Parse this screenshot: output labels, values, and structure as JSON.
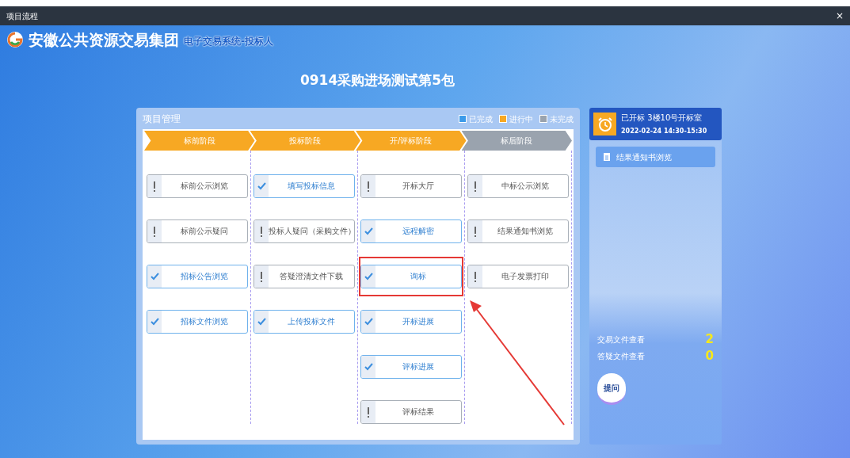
{
  "window": {
    "title": "项目流程",
    "close": "×"
  },
  "header": {
    "brand": "安徽公共资源交易集团",
    "subtitle": "电子交易系统-投标人"
  },
  "project_title": "0914采购进场测试第5包",
  "panel": {
    "title": "项目管理",
    "legend": [
      {
        "label": "已完成",
        "color": "#3d9be9"
      },
      {
        "label": "进行中",
        "color": "#f7a823"
      },
      {
        "label": "未完成",
        "color": "#9aa3ae"
      }
    ],
    "stages": [
      {
        "label": "标前阶段",
        "color": "#f7a823",
        "items": [
          {
            "label": "标前公示浏览",
            "done": false,
            "highlighted": false
          },
          {
            "label": "标前公示疑问",
            "done": false,
            "highlighted": false
          },
          {
            "label": "招标公告浏览",
            "done": true,
            "highlighted": false
          },
          {
            "label": "招标文件浏览",
            "done": true,
            "highlighted": false
          }
        ]
      },
      {
        "label": "投标阶段",
        "color": "#f7a823",
        "items": [
          {
            "label": "填写投标信息",
            "done": true,
            "highlighted": false
          },
          {
            "label": "投标人疑问（采购文件）",
            "done": false,
            "highlighted": false
          },
          {
            "label": "答疑澄清文件下载",
            "done": false,
            "highlighted": false
          },
          {
            "label": "上传投标文件",
            "done": true,
            "highlighted": false
          }
        ]
      },
      {
        "label": "开/评标阶段",
        "color": "#f7a823",
        "items": [
          {
            "label": "开标大厅",
            "done": false,
            "highlighted": false
          },
          {
            "label": "远程解密",
            "done": true,
            "highlighted": false
          },
          {
            "label": "询标",
            "done": true,
            "highlighted": true
          },
          {
            "label": "开标进展",
            "done": true,
            "highlighted": false
          },
          {
            "label": "评标进展",
            "done": true,
            "highlighted": false
          },
          {
            "label": "评标结果",
            "done": false,
            "highlighted": false
          }
        ]
      },
      {
        "label": "标后阶段",
        "color": "#9aa3ae",
        "items": [
          {
            "label": "中标公示浏览",
            "done": false,
            "highlighted": false
          },
          {
            "label": "结果通知书浏览",
            "done": false,
            "highlighted": false
          },
          {
            "label": "电子发票打印",
            "done": false,
            "highlighted": false
          }
        ]
      }
    ]
  },
  "side": {
    "status": "已开标 3楼10号开标室",
    "time": "2022-02-24 14:30-15:30",
    "link": "结果通知书浏览",
    "counts": [
      {
        "label": "交易文件查看",
        "value": "2"
      },
      {
        "label": "答疑文件查看",
        "value": "0"
      }
    ],
    "ask_button": "提问"
  }
}
